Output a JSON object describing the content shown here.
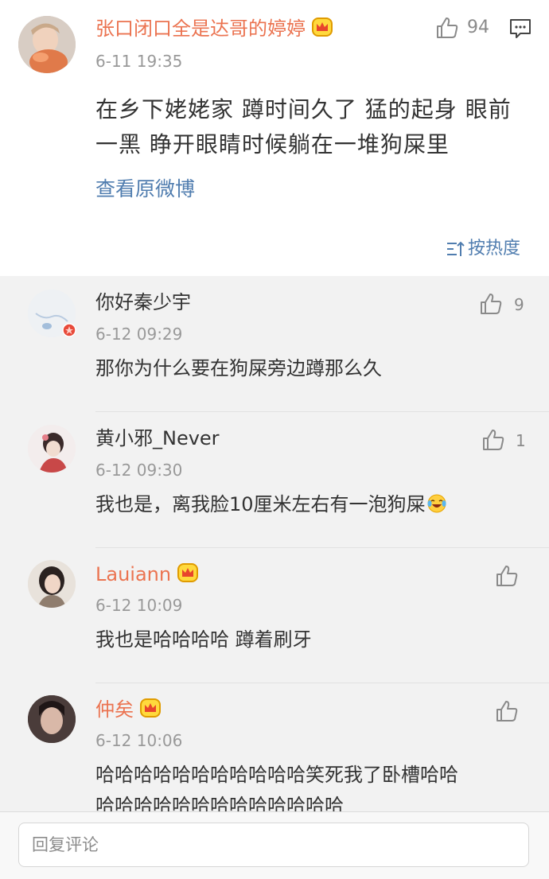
{
  "original_post": {
    "user_name": "张口闭口全是达哥的婷婷",
    "time": "6-11 19:35",
    "likes": "94",
    "text": "在乡下姥姥家 蹲时间久了 猛的起身 眼前一黑 睁开眼睛时候躺在一堆狗屎里",
    "view_original": "查看原微博",
    "sort_label": "按热度"
  },
  "comments": [
    {
      "name": "你好秦少宇",
      "time": "6-12 09:29",
      "likes": "9",
      "text": "那你为什么要在狗屎旁边蹲那么久"
    },
    {
      "name": "黄小邪_Never",
      "time": "6-12 09:30",
      "likes": "1",
      "text": "我也是，离我脸10厘米左右有一泡狗屎"
    },
    {
      "name": "Lauiann",
      "time": "6-12 10:09",
      "likes": "",
      "text": "我也是哈哈哈哈 蹲着刷牙"
    },
    {
      "name": "仲矣",
      "time": "6-12 10:06",
      "likes": "",
      "text": "哈哈哈哈哈哈哈哈哈哈哈笑死我了卧槽哈哈",
      "text2": "哈哈哈哈哈哈哈哈哈哈哈哈哈"
    }
  ],
  "reply_bar": {
    "placeholder": "回复评论"
  },
  "colors": {
    "vip_name": "#eb7350",
    "link": "#507daf",
    "text": "#333333",
    "meta": "#999999"
  },
  "icons": [
    "like-icon",
    "comment-icon",
    "crown-badge-icon",
    "verified-badge-icon",
    "laughing-emoji-icon",
    "sort-icon"
  ]
}
